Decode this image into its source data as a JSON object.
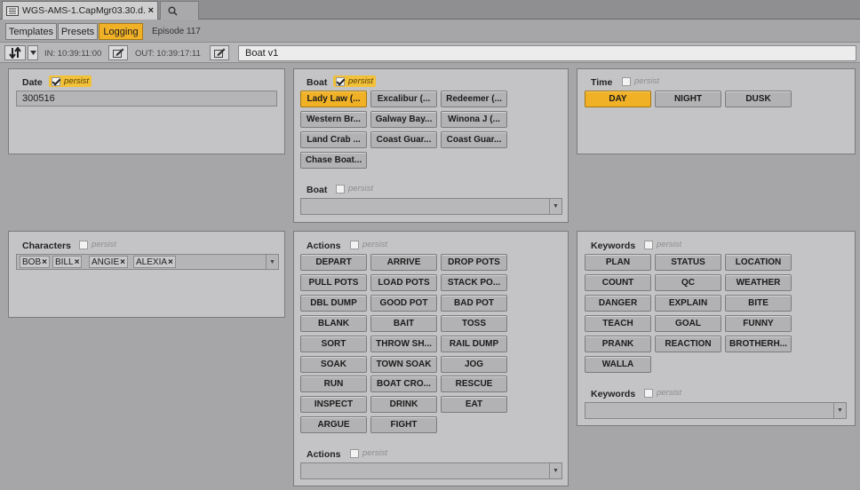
{
  "window": {
    "doc_tab": "WGS-AMS-1.CapMgr03.30.d...",
    "doc_close": "×",
    "search_tab": "🔍"
  },
  "subtabs": [
    "Templates",
    "Presets",
    "Logging"
  ],
  "episode": "Episode 117",
  "toolbar": {
    "in_label": "IN: 10:39:11:00",
    "out_label": "OUT: 10:39:17:11",
    "clip_name": "Boat v1"
  },
  "persist_label": "persist",
  "token_x": "×",
  "date": {
    "label": "Date",
    "value": "300516"
  },
  "boat": {
    "label": "Boat",
    "buttons": [
      "Lady Law (...",
      "Excalibur (...",
      "Redeemer (...",
      "Western Br...",
      "Galway Bay...",
      "Winona J (...",
      "Land Crab ...",
      "Coast Guar...",
      "Coast Guar...",
      "Chase Boat..."
    ],
    "selected": "Lady Law (...",
    "dropdown_label": "Boat"
  },
  "time": {
    "label": "Time",
    "buttons": [
      "DAY",
      "NIGHT",
      "DUSK"
    ],
    "selected": "DAY"
  },
  "characters": {
    "label": "Characters",
    "tokens": [
      "BOB",
      "BILL",
      "ANGIE",
      "ALEXIA"
    ]
  },
  "actions": {
    "label": "Actions",
    "buttons": [
      "DEPART",
      "ARRIVE",
      "DROP POTS",
      "PULL POTS",
      "LOAD POTS",
      "STACK PO...",
      "DBL DUMP",
      "GOOD POT",
      "BAD POT",
      "BLANK",
      "BAIT",
      "TOSS",
      "SORT",
      "THROW SH...",
      "RAIL DUMP",
      "SOAK",
      "TOWN SOAK",
      "JOG",
      "RUN",
      "BOAT CRO...",
      "RESCUE",
      "INSPECT",
      "DRINK",
      "EAT",
      "ARGUE",
      "FIGHT"
    ],
    "dropdown_label": "Actions"
  },
  "keywords": {
    "label": "Keywords",
    "buttons": [
      "PLAN",
      "STATUS",
      "LOCATION",
      "COUNT",
      "QC",
      "WEATHER",
      "DANGER",
      "EXPLAIN",
      "BITE",
      "TEACH",
      "GOAL",
      "FUNNY",
      "PRANK",
      "REACTION",
      "BROTHERH...",
      "WALLA"
    ],
    "dropdown_label": "Keywords"
  }
}
